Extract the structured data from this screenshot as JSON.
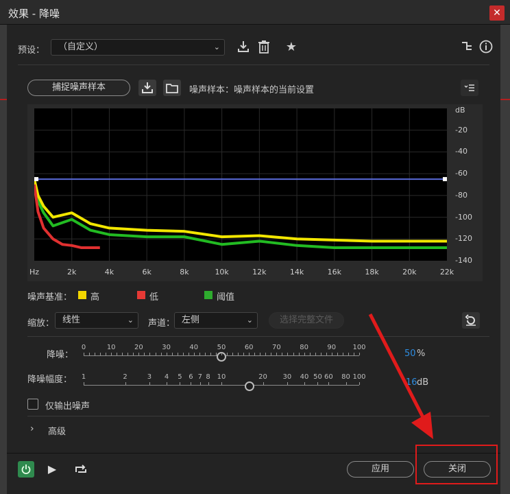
{
  "window": {
    "title": "效果 - 降噪",
    "close_icon": "close-icon"
  },
  "preset": {
    "label": "预设：",
    "value": "（自定义）"
  },
  "noise": {
    "capture_button": "捕捉噪声样本",
    "sample_label": "噪声样本：噪声样本的当前设置"
  },
  "graph": {
    "y_unit": "dB",
    "y_ticks": [
      "-20",
      "-40",
      "-60",
      "-80",
      "-100",
      "-120",
      "-140"
    ],
    "x_ticks": [
      "Hz",
      "2k",
      "4k",
      "6k",
      "8k",
      "10k",
      "12k",
      "14k",
      "16k",
      "18k",
      "20k",
      "22k"
    ]
  },
  "chart_data": {
    "type": "line",
    "xlabel": "",
    "ylabel": "",
    "x_ticks": [
      "Hz",
      "2k",
      "4k",
      "6k",
      "8k",
      "10k",
      "12k",
      "14k",
      "16k",
      "18k",
      "20k",
      "22k"
    ],
    "y_unit": "dB",
    "ylim": [
      -140,
      0
    ],
    "xlim": [
      0,
      22000
    ],
    "series": [
      {
        "name": "高",
        "color": "#f2e600",
        "x": [
          0,
          200,
          500,
          1000,
          2000,
          3000,
          4000,
          6000,
          8000,
          10000,
          12000,
          14000,
          16000,
          18000,
          20000,
          22000
        ],
        "values": [
          -65,
          -80,
          -90,
          -100,
          -96,
          -106,
          -110,
          -112,
          -113,
          -118,
          -117,
          -120,
          -121,
          -122,
          -122,
          -122
        ]
      },
      {
        "name": "低",
        "color": "#e03030",
        "x": [
          0,
          200,
          500,
          1000,
          1500,
          2000,
          2500,
          3500
        ],
        "values": [
          -70,
          -95,
          -110,
          -120,
          -125,
          -126,
          -128,
          -128
        ]
      },
      {
        "name": "阈值",
        "color": "#22bb22",
        "x": [
          0,
          200,
          500,
          1000,
          2000,
          3000,
          4000,
          6000,
          8000,
          10000,
          12000,
          14000,
          16000,
          18000,
          20000,
          22000
        ],
        "values": [
          -68,
          -85,
          -96,
          -108,
          -102,
          -112,
          -116,
          -118,
          -118,
          -125,
          -122,
          -126,
          -128,
          -128,
          -128,
          -128
        ]
      }
    ],
    "threshold_line": -65
  },
  "legend": {
    "label": "噪声基准：",
    "high": "高",
    "low": "低",
    "threshold": "阈值",
    "colors": {
      "high": "#f2d600",
      "low": "#e53935",
      "threshold": "#2eab2e"
    }
  },
  "controls": {
    "scale_label": "缩放：",
    "scale_value": "线性",
    "channel_label": "声道：",
    "channel_value": "左侧",
    "select_file": "选择完整文件"
  },
  "reduction": {
    "label": "降噪：",
    "value": 50,
    "unit": "%",
    "scale": [
      "0",
      "10",
      "20",
      "30",
      "40",
      "50",
      "60",
      "70",
      "80",
      "90",
      "100"
    ],
    "scale_zero": "0"
  },
  "reduce_by": {
    "label": "降噪幅度：",
    "value": 16,
    "unit": "dB",
    "scale": [
      "1",
      "2",
      "3",
      "4",
      "5",
      "6",
      "7",
      "8",
      "10",
      "20",
      "30",
      "40",
      "50",
      "60",
      "80",
      "100"
    ]
  },
  "output_noise_only": {
    "label": "仅输出噪声",
    "checked": false
  },
  "advanced": {
    "label": "高级"
  },
  "footer": {
    "apply": "应用",
    "close": "关闭"
  }
}
